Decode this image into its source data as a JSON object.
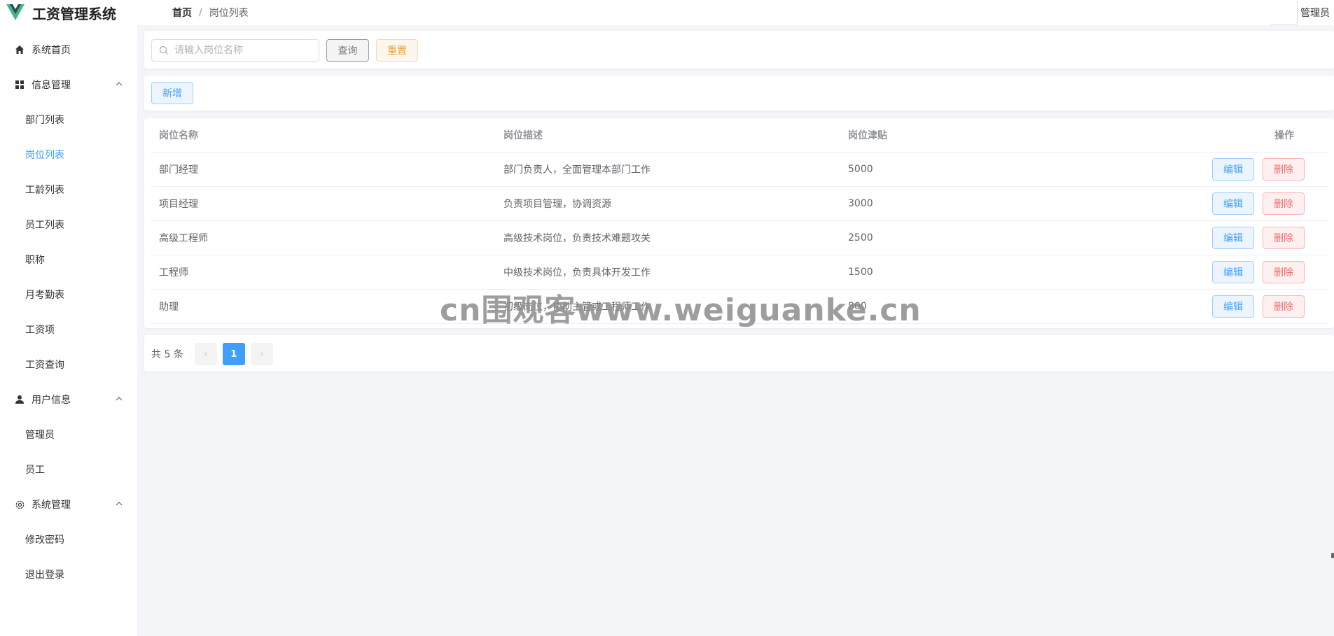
{
  "header": {
    "title": "工资管理系统",
    "breadcrumb": {
      "home": "首页",
      "separator": "/",
      "current": "岗位列表"
    },
    "user_name": "管理员"
  },
  "sidebar": {
    "items": [
      {
        "label": "系统首页",
        "icon": "home-icon",
        "level": "top"
      },
      {
        "label": "信息管理",
        "icon": "grid-icon",
        "level": "top",
        "expanded": true
      },
      {
        "label": "部门列表",
        "level": "sub"
      },
      {
        "label": "岗位列表",
        "level": "sub",
        "active": true
      },
      {
        "label": "工龄列表",
        "level": "sub"
      },
      {
        "label": "员工列表",
        "level": "sub"
      },
      {
        "label": "职称",
        "level": "sub"
      },
      {
        "label": "月考勤表",
        "level": "sub"
      },
      {
        "label": "工资项",
        "level": "sub"
      },
      {
        "label": "工资查询",
        "level": "sub"
      },
      {
        "label": "用户信息",
        "icon": "user-icon",
        "level": "top",
        "expanded": true
      },
      {
        "label": "管理员",
        "level": "sub"
      },
      {
        "label": "员工",
        "level": "sub"
      },
      {
        "label": "系统管理",
        "icon": "gear-icon",
        "level": "top",
        "expanded": true
      },
      {
        "label": "修改密码",
        "level": "sub"
      },
      {
        "label": "退出登录",
        "level": "sub"
      }
    ]
  },
  "search": {
    "placeholder": "请输入岗位名称",
    "value": "",
    "query_label": "查询",
    "reset_label": "重置"
  },
  "actions": {
    "add_label": "新增"
  },
  "table": {
    "columns": [
      "岗位名称",
      "岗位描述",
      "岗位津贴",
      "操作"
    ],
    "rows": [
      {
        "name": "部门经理",
        "desc": "部门负责人，全面管理本部门工作",
        "allowance": "5000"
      },
      {
        "name": "项目经理",
        "desc": "负责项目管理，协调资源",
        "allowance": "3000"
      },
      {
        "name": "高级工程师",
        "desc": "高级技术岗位，负责技术难题攻关",
        "allowance": "2500"
      },
      {
        "name": "工程师",
        "desc": "中级技术岗位，负责具体开发工作",
        "allowance": "1500"
      },
      {
        "name": "助理",
        "desc": "初级岗位，协助主管或工程师工作",
        "allowance": "800"
      }
    ],
    "edit_label": "编辑",
    "delete_label": "删除"
  },
  "pager": {
    "total_text": "共 5 条",
    "prev": "‹",
    "current": "1",
    "next": "›"
  },
  "watermark": "cn围观客www.weiguanke.cn",
  "colors": {
    "primary": "#409eff",
    "danger": "#f56c6c",
    "warning": "#e6a23c",
    "logo_dark": "#35495e",
    "logo_green": "#41b883",
    "main_bg": "#f4f5f8"
  }
}
